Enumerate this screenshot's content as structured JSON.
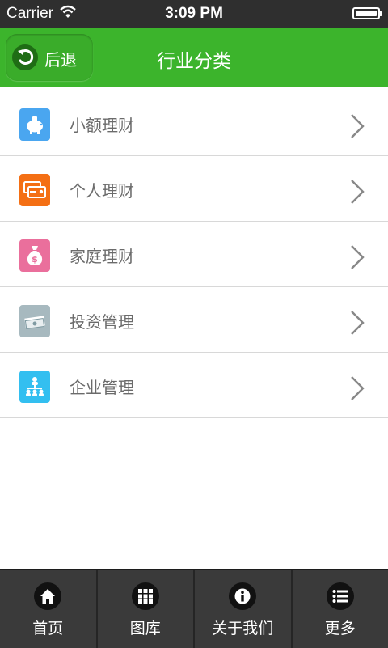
{
  "status_bar": {
    "carrier": "Carrier",
    "time": "3:09 PM"
  },
  "header": {
    "back_label": "后退",
    "title": "行业分类"
  },
  "list": {
    "items": [
      {
        "label": "小额理财",
        "icon": "piggy-bank-icon",
        "color": "#4aa6f0"
      },
      {
        "label": "个人理财",
        "icon": "cards-icon",
        "color": "#f46f14"
      },
      {
        "label": "家庭理财",
        "icon": "money-bag-icon",
        "color": "#ea6f9c"
      },
      {
        "label": "投资管理",
        "icon": "cash-stack-icon",
        "color": "#a7b9bf"
      },
      {
        "label": "企业管理",
        "icon": "org-chart-icon",
        "color": "#33bff0"
      }
    ]
  },
  "tab_bar": {
    "tabs": [
      {
        "label": "首页",
        "icon": "home-icon"
      },
      {
        "label": "图库",
        "icon": "grid-icon"
      },
      {
        "label": "关于我们",
        "icon": "info-icon"
      },
      {
        "label": "更多",
        "icon": "list-icon"
      }
    ]
  }
}
